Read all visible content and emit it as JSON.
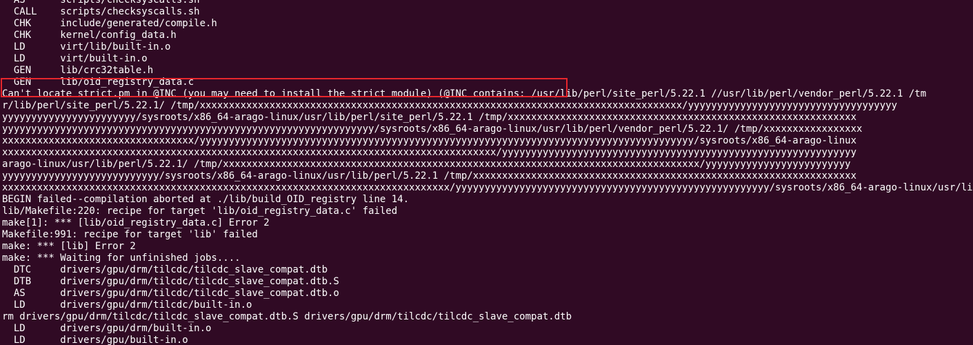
{
  "terminal": {
    "lines": [
      "  AS      scripts/checksyscalls.sh",
      "  CALL    scripts/checksyscalls.sh",
      "  CHK     include/generated/compile.h",
      "  CHK     kernel/config_data.h",
      "  LD      virt/lib/built-in.o",
      "  LD      virt/built-in.o",
      "  GEN     lib/crc32table.h",
      "  GEN     lib/oid_registry_data.c",
      "Can't locate strict.pm in @INC (you may need to install the strict module) (@INC contains: /usr/lib/perl/site_perl/5.22.1 //usr/lib/perl/vendor_perl/5.22.1 /tm",
      "r/lib/perl/site_perl/5.22.1/ /tmp/xxxxxxxxxxxxxxxxxxxxxxxxxxxxxxxxxxxxxxxxxxxxxxxxxxxxxxxxxxxxxxxxxxxxxxxxxxxxxxxxxxx/yyyyyyyyyyyyyyyyyyyyyyyyyyyyyyyyyyyy",
      "yyyyyyyyyyyyyyyyyyyyyyy/sysroots/x86_64-arago-linux/usr/lib/perl/site_perl/5.22.1 /tmp/xxxxxxxxxxxxxxxxxxxxxxxxxxxxxxxxxxxxxxxxxxxxxxxxxxxxxxxxxxxx",
      "yyyyyyyyyyyyyyyyyyyyyyyyyyyyyyyyyyyyyyyyyyyyyyyyyyyyyyyyyyyyyyyy/sysroots/x86_64-arago-linux/usr/lib/perl/vendor_perl/5.22.1/ /tmp/xxxxxxxxxxxxxxxxx",
      "xxxxxxxxxxxxxxxxxxxxxxxxxxxxxxxxx/yyyyyyyyyyyyyyyyyyyyyyyyyyyyyyyyyyyyyyyyyyyyyyyyyyyyyyyyyyyyyyyyyyyyyyyyyyyyyyyyyyyyy/sysroots/x86_64-arago-linux",
      "xxxxxxxxxxxxxxxxxxxxxxxxxxxxxxxxxxxxxxxxxxxxxxxxxxxxxxxxxxxxxxxxxxxxxxxxxxxxxxxxxxxxx/yyyyyyyyyyyyyyyyyyyyyyyyyyyyyyyyyyyyyyyyyyyyyyyyyyyyyyyyyyyyy",
      "arago-linux/usr/lib/perl/5.22.1/ /tmp/xxxxxxxxxxxxxxxxxxxxxxxxxxxxxxxxxxxxxxxxxxxxxxxxxxxxxxxxxxxxxxxxxxxxxxxxxxxxxxxxxx/yyyyyyyyyyyyyyyyyyyyyyyyy",
      "yyyyyyyyyyyyyyyyyyyyyyyyyyy/sysroots/x86_64-arago-linux/usr/lib/perl/5.22.1 /tmp/xxxxxxxxxxxxxxxxxxxxxxxxxxxxxxxxxxxxxxxxxxxxxxxxxxxxxxxxxxxxxxxxxx",
      "xxxxxxxxxxxxxxxxxxxxxxxxxxxxxxxxxxxxxxxxxxxxxxxxxxxxxxxxxxxxxxxxxxxxxxxxxxxxx/yyyyyyyyyyyyyyyyyyyyyyyyyyyyyyyyyyyyyyyyyyyyyyyyyyyyyy/sysroots/x86_64-arago-linux/usr/lib/perl/5.22.1 .) at ./lib/build_OID_registry line 14.",
      "BEGIN failed--compilation aborted at ./lib/build_OID_registry line 14.",
      "lib/Makefile:220: recipe for target 'lib/oid_registry_data.c' failed",
      "make[1]: *** [lib/oid_registry_data.c] Error 2",
      "Makefile:991: recipe for target 'lib' failed",
      "make: *** [lib] Error 2",
      "make: *** Waiting for unfinished jobs....",
      "  DTC     drivers/gpu/drm/tilcdc/tilcdc_slave_compat.dtb",
      "  DTB     drivers/gpu/drm/tilcdc/tilcdc_slave_compat.dtb.S",
      "  AS      drivers/gpu/drm/tilcdc/tilcdc_slave_compat.dtb.o",
      "  LD      drivers/gpu/drm/tilcdc/built-in.o",
      "rm drivers/gpu/drm/tilcdc/tilcdc_slave_compat.dtb.S drivers/gpu/drm/tilcdc/tilcdc_slave_compat.dtb",
      "  LD      drivers/gpu/drm/built-in.o",
      "  LD      drivers/gpu/built-in.o"
    ],
    "colors": {
      "background": "#300a24",
      "foreground": "#ffffff",
      "highlight_border": "#e8262c"
    }
  }
}
